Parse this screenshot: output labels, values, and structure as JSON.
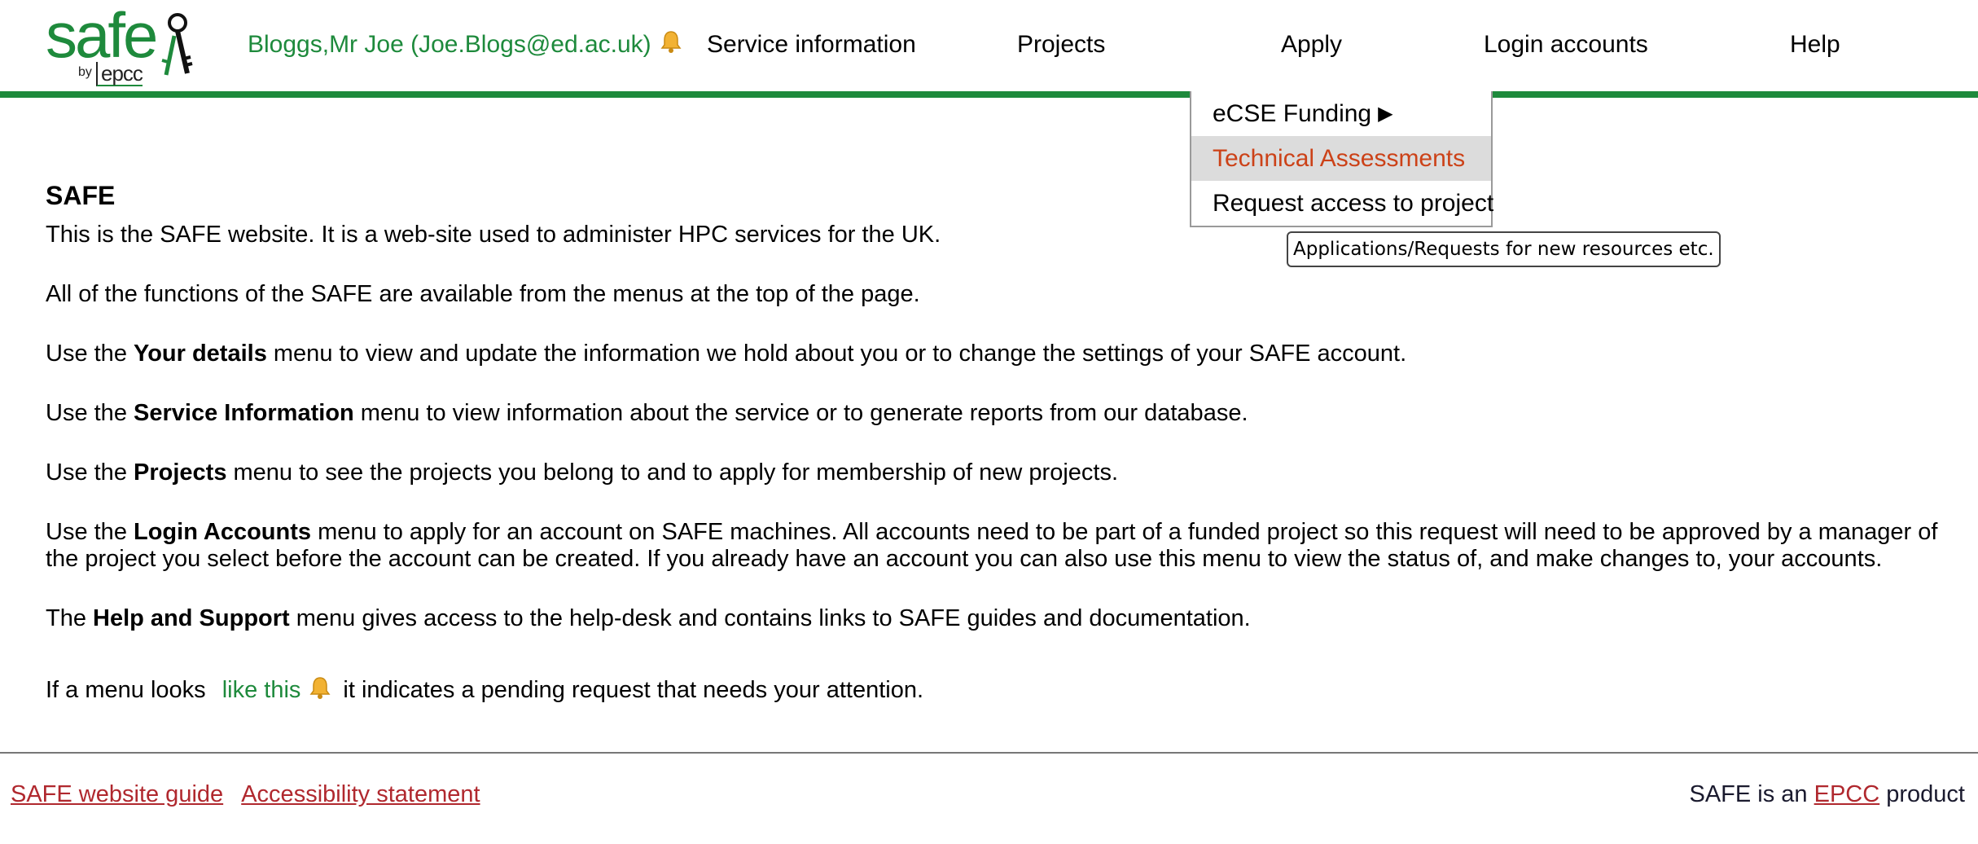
{
  "header": {
    "logo": {
      "word": "safe",
      "by": "by",
      "brand": "epcc"
    },
    "user": {
      "label": "Bloggs,Mr Joe (Joe.Blogs@ed.ac.uk)",
      "icon": "bell-icon"
    },
    "nav": [
      {
        "label": "Service information"
      },
      {
        "label": "Projects"
      },
      {
        "label": "Apply"
      },
      {
        "label": "Login accounts"
      },
      {
        "label": "Help"
      }
    ],
    "apply_menu": {
      "items": [
        {
          "label": "eCSE Funding",
          "submenu_arrow": "▶"
        },
        {
          "label": "Technical Assessments"
        },
        {
          "label": "Request access to project"
        }
      ],
      "highlighted_index": 1
    },
    "tooltip": "Applications/Requests for new resources etc."
  },
  "main": {
    "title": "SAFE",
    "intro": "This is the SAFE website. It is a web-site used to administer HPC services for the UK.",
    "functions": "All of the functions of the SAFE are available from the menus at the top of the page.",
    "your_details": {
      "pre": "Use the ",
      "bold": "Your details",
      "post": " menu to view and update the information we hold about you or to change the settings of your SAFE account."
    },
    "service_information": {
      "pre": "Use the ",
      "bold": "Service Information",
      "post": " menu to view information about the service or to generate reports from our database."
    },
    "projects": {
      "pre": "Use the ",
      "bold": "Projects",
      "post": " menu to see the projects you belong to and to apply for membership of new projects."
    },
    "login_accounts": {
      "pre": "Use the ",
      "bold": "Login Accounts",
      "post": " menu to apply for an account on SAFE machines. All accounts need to be part of a funded project so this request will need to be approved by a manager of the project you select before the account can be created. If you already have an account you can also use this menu to view the status of, and make changes to, your accounts."
    },
    "help_support": {
      "pre": "The ",
      "bold": "Help and Support",
      "post": " menu gives access to the help-desk and contains links to SAFE guides and documentation."
    },
    "pending": {
      "pre": "If a menu looks ",
      "example": "like this",
      "post": "it indicates a pending request that needs your attention."
    }
  },
  "footer": {
    "guide_link": "SAFE website guide",
    "accessibility_link": "Accessibility statement",
    "product_pre": "SAFE is an ",
    "product_link": "EPCC",
    "product_post": " product"
  },
  "colors": {
    "brand_green": "#1e8a3c",
    "highlight_text": "#cc4218",
    "footer_link": "#b0282e"
  }
}
